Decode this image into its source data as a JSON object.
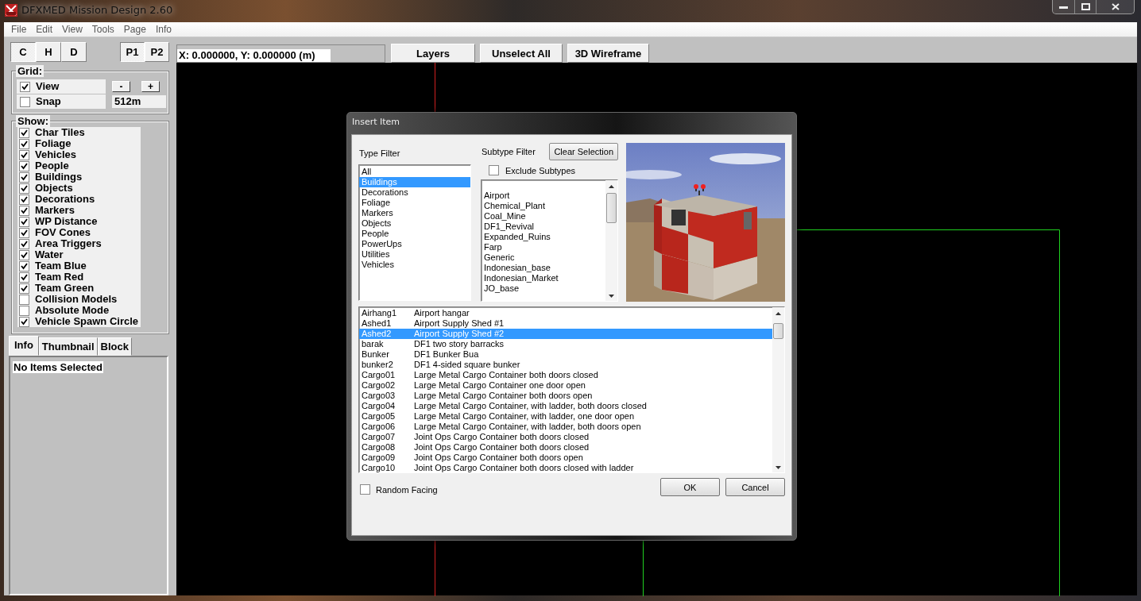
{
  "window": {
    "title": "DFXMED Mission Design 2.60"
  },
  "menu": [
    "File",
    "Edit",
    "View",
    "Tools",
    "Page",
    "Info"
  ],
  "view_buttons": [
    {
      "label": "C",
      "selected": true
    },
    {
      "label": "H",
      "selected": false
    },
    {
      "label": "D",
      "selected": false
    }
  ],
  "page_buttons": [
    {
      "label": "P1",
      "selected": true
    },
    {
      "label": "P2",
      "selected": false
    }
  ],
  "grid": {
    "title": "Grid:",
    "view": {
      "label": "View",
      "checked": true
    },
    "minus": "-",
    "plus": "+",
    "snap": {
      "label": "Snap",
      "checked": false
    },
    "snap_value": "512m"
  },
  "show": {
    "title": "Show:",
    "items": [
      {
        "label": "Char Tiles",
        "checked": true
      },
      {
        "label": "Foliage",
        "checked": true
      },
      {
        "label": "Vehicles",
        "checked": true
      },
      {
        "label": "People",
        "checked": true
      },
      {
        "label": "Buildings",
        "checked": true
      },
      {
        "label": "Objects",
        "checked": true
      },
      {
        "label": "Decorations",
        "checked": true
      },
      {
        "label": "Markers",
        "checked": true
      },
      {
        "label": "WP Distance",
        "checked": true
      },
      {
        "label": "FOV Cones",
        "checked": true
      },
      {
        "label": "Area Triggers",
        "checked": true
      },
      {
        "label": "Water",
        "checked": true
      },
      {
        "label": "Team Blue",
        "checked": true
      },
      {
        "label": "Team Red",
        "checked": true
      },
      {
        "label": "Team Green",
        "checked": true
      },
      {
        "label": "Collision Models",
        "checked": false
      },
      {
        "label": "Absolute Mode",
        "checked": false
      },
      {
        "label": "Vehicle Spawn Circle",
        "checked": true
      }
    ]
  },
  "panel_tabs": [
    {
      "label": "Info",
      "selected": true
    },
    {
      "label": "Thumbnail",
      "selected": false
    },
    {
      "label": "Block",
      "selected": false
    }
  ],
  "info_text": "No Items Selected",
  "coordinates": "X: 0.000000, Y: 0.000000 (m)",
  "toolbar_buttons": [
    "Layers",
    "Unselect All",
    "3D Wireframe"
  ],
  "dialog": {
    "title": "Insert Item",
    "type_filter": {
      "label": "Type Filter",
      "items": [
        {
          "label": "All",
          "selected": false
        },
        {
          "label": "Buildings",
          "selected": true
        },
        {
          "label": "Decorations",
          "selected": false
        },
        {
          "label": "Foliage",
          "selected": false
        },
        {
          "label": "Markers",
          "selected": false
        },
        {
          "label": "Objects",
          "selected": false
        },
        {
          "label": "People",
          "selected": false
        },
        {
          "label": "PowerUps",
          "selected": false
        },
        {
          "label": "Utilities",
          "selected": false
        },
        {
          "label": "Vehicles",
          "selected": false
        }
      ]
    },
    "subtype_filter": {
      "label": "Subtype Filter",
      "clear_button": "Clear Selection",
      "exclude": {
        "label": "Exclude Subtypes",
        "checked": false
      },
      "items": [
        "Airport",
        "Chemical_Plant",
        "Coal_Mine",
        "DF1_Revival",
        "Expanded_Ruins",
        "Farp",
        "Generic",
        "Indonesian_base",
        "Indonesian_Market",
        "JO_base"
      ]
    },
    "items": [
      {
        "name": "Airhang1",
        "description": "Airport hangar",
        "selected": false
      },
      {
        "name": "Ashed1",
        "description": "Airport Supply Shed #1",
        "selected": false
      },
      {
        "name": "Ashed2",
        "description": "Airport Supply Shed #2",
        "selected": true
      },
      {
        "name": "barak",
        "description": "DF1 two story barracks",
        "selected": false
      },
      {
        "name": "Bunker",
        "description": "DF1 Bunker Bua",
        "selected": false
      },
      {
        "name": "bunker2",
        "description": "DF1 4-sided square bunker",
        "selected": false
      },
      {
        "name": "Cargo01",
        "description": "Large Metal Cargo Container both doors closed",
        "selected": false
      },
      {
        "name": "Cargo02",
        "description": "Large Metal Cargo Container one door open",
        "selected": false
      },
      {
        "name": "Cargo03",
        "description": "Large Metal Cargo Container both doors open",
        "selected": false
      },
      {
        "name": "Cargo04",
        "description": "Large Metal Cargo Container, with ladder, both doors closed",
        "selected": false
      },
      {
        "name": "Cargo05",
        "description": "Large Metal Cargo Container, with ladder, one door open",
        "selected": false
      },
      {
        "name": "Cargo06",
        "description": "Large Metal Cargo Container, with ladder, both doors open",
        "selected": false
      },
      {
        "name": "Cargo07",
        "description": "Joint Ops Cargo Container both doors closed",
        "selected": false
      },
      {
        "name": "Cargo08",
        "description": "Joint Ops Cargo Container both doors closed",
        "selected": false
      },
      {
        "name": "Cargo09",
        "description": "Joint Ops Cargo Container both doors open",
        "selected": false
      },
      {
        "name": "Cargo10",
        "description": "Joint Ops Cargo Container both doors closed with ladder",
        "selected": false
      }
    ],
    "random_facing": {
      "label": "Random Facing",
      "checked": false
    },
    "buttons": [
      "OK",
      "Cancel"
    ]
  }
}
